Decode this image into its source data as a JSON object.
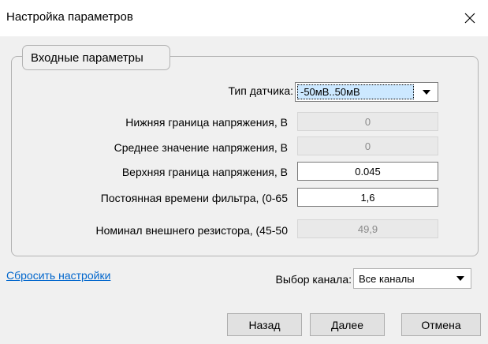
{
  "window": {
    "title": "Настройка параметров",
    "close_icon": "close-icon"
  },
  "group": {
    "title": "Входные параметры"
  },
  "sensor": {
    "label": "Тип датчика:",
    "value": "-50мВ..50мВ"
  },
  "fields": [
    {
      "label": "Нижняя граница напряжения, В",
      "value": "0",
      "readonly": true
    },
    {
      "label": "Среднее значение напряжения, В",
      "value": "0",
      "readonly": true
    },
    {
      "label": "Верхняя граница напряжения, В",
      "value": "0.045",
      "readonly": false
    },
    {
      "label": "Постоянная времени фильтра, (0-65",
      "value": "1,6",
      "readonly": false
    },
    {
      "label": "Номинал внешнего резистора, (45-50",
      "value": "49,9",
      "readonly": true
    }
  ],
  "reset_link": "Сбросить настройки",
  "channel": {
    "label": "Выбор канала:",
    "value": "Все каналы"
  },
  "buttons": {
    "back": "Назад",
    "next": "Далее",
    "cancel": "Отмена"
  },
  "colors": {
    "link": "#0066cc",
    "selection": "#cce8ff",
    "dialog_bg": "#f0f0f0"
  }
}
